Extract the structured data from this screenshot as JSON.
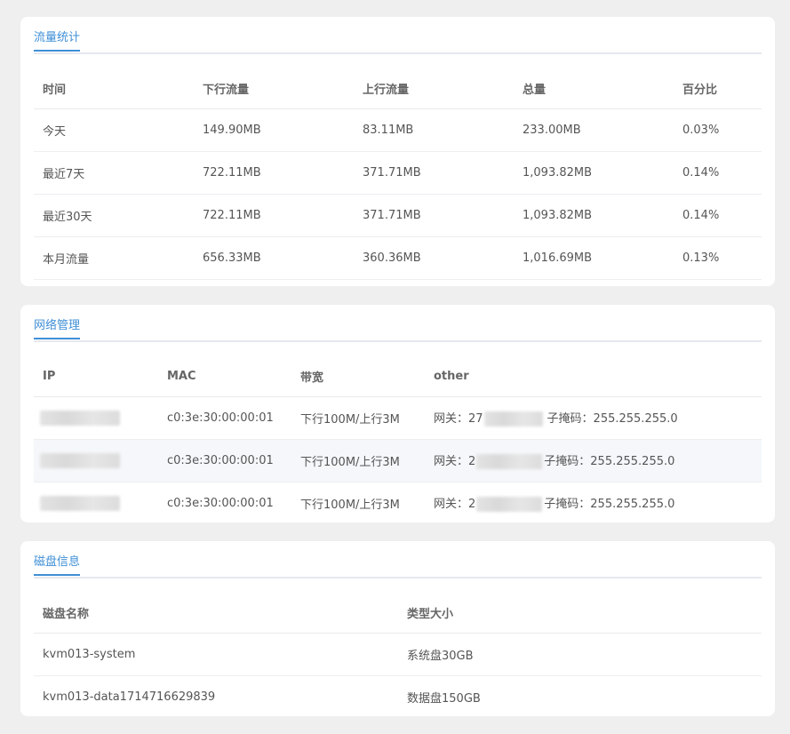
{
  "traffic": {
    "title": "流量统计",
    "headers": [
      "时间",
      "下行流量",
      "上行流量",
      "总量",
      "百分比"
    ],
    "rows": [
      {
        "period": "今天",
        "down": "149.90MB",
        "up": "83.11MB",
        "total": "233.00MB",
        "percent": "0.03%"
      },
      {
        "period": "最近7天",
        "down": "722.11MB",
        "up": "371.71MB",
        "total": "1,093.82MB",
        "percent": "0.14%"
      },
      {
        "period": "最近30天",
        "down": "722.11MB",
        "up": "371.71MB",
        "total": "1,093.82MB",
        "percent": "0.14%"
      },
      {
        "period": "本月流量",
        "down": "656.33MB",
        "up": "360.36MB",
        "total": "1,016.69MB",
        "percent": "0.13%"
      }
    ]
  },
  "network": {
    "title": "网络管理",
    "headers": [
      "IP",
      "MAC",
      "带宽",
      "other"
    ],
    "rows": [
      {
        "mac": "c0:3e:30:00:00:01",
        "bandwidth": "下行100M/上行3M",
        "gateway_prefix": "网关：27",
        "mask": "子掩码：255.255.255.0"
      },
      {
        "mac": "c0:3e:30:00:00:01",
        "bandwidth": "下行100M/上行3M",
        "gateway_prefix": "网关：2",
        "mask": "子掩码：255.255.255.0"
      },
      {
        "mac": "c0:3e:30:00:00:01",
        "bandwidth": "下行100M/上行3M",
        "gateway_prefix": "网关：2",
        "mask": "子掩码：255.255.255.0"
      }
    ]
  },
  "disk": {
    "title": "磁盘信息",
    "headers": [
      "磁盘名称",
      "类型大小"
    ],
    "rows": [
      {
        "name": "kvm013-system",
        "type": "系统盘30GB"
      },
      {
        "name": "kvm013-data1714716629839",
        "type": "数据盘150GB"
      }
    ]
  }
}
